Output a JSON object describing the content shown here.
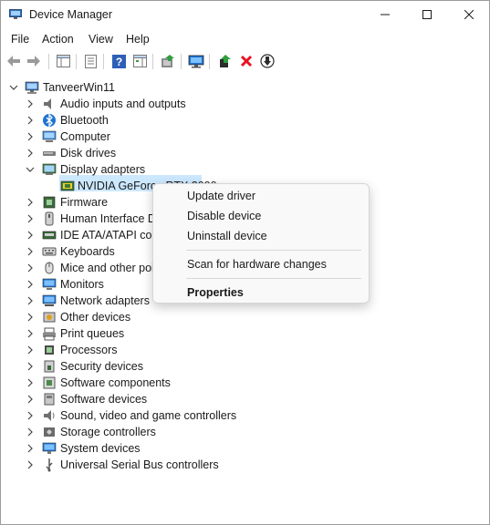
{
  "window": {
    "title": "Device Manager"
  },
  "menu": [
    "File",
    "Action",
    "View",
    "Help"
  ],
  "toolbar": {
    "icons": [
      "back-arrow-icon",
      "forward-arrow-icon",
      "show-hide-console-tree-icon",
      "properties-icon",
      "help-icon",
      "action-pane-icon",
      "update-driver-icon",
      "scan-hardware-icon",
      "enable-device-icon",
      "uninstall-icon",
      "download-driver-icon"
    ]
  },
  "tree": {
    "root": "TanveerWin11",
    "categories": [
      {
        "label": "Audio inputs and outputs",
        "icon": "speaker-icon"
      },
      {
        "label": "Bluetooth",
        "icon": "bluetooth-icon"
      },
      {
        "label": "Computer",
        "icon": "computer-icon"
      },
      {
        "label": "Disk drives",
        "icon": "disk-drive-icon"
      },
      {
        "label": "Display adapters",
        "icon": "display-adapter-icon",
        "expanded": true
      },
      {
        "label": "Firmware",
        "icon": "firmware-icon"
      },
      {
        "label": "Human Interface D",
        "icon": "hid-icon"
      },
      {
        "label": "IDE ATA/ATAPI cont",
        "icon": "ide-controller-icon"
      },
      {
        "label": "Keyboards",
        "icon": "keyboard-icon"
      },
      {
        "label": "Mice and other poi",
        "icon": "mouse-icon"
      },
      {
        "label": "Monitors",
        "icon": "monitor-icon"
      },
      {
        "label": "Network adapters",
        "icon": "network-adapter-icon"
      },
      {
        "label": "Other devices",
        "icon": "other-devices-icon"
      },
      {
        "label": "Print queues",
        "icon": "printer-icon"
      },
      {
        "label": "Processors",
        "icon": "processor-icon"
      },
      {
        "label": "Security devices",
        "icon": "security-icon"
      },
      {
        "label": "Software components",
        "icon": "software-component-icon"
      },
      {
        "label": "Software devices",
        "icon": "software-device-icon"
      },
      {
        "label": "Sound, video and game controllers",
        "icon": "sound-icon"
      },
      {
        "label": "Storage controllers",
        "icon": "storage-controller-icon"
      },
      {
        "label": "System devices",
        "icon": "system-device-icon"
      },
      {
        "label": "Universal Serial Bus controllers",
        "icon": "usb-icon"
      }
    ],
    "child": {
      "label": "NVIDIA GeForce RTX 3090",
      "icon": "gpu-icon"
    }
  },
  "context_menu": {
    "items": [
      "Update driver",
      "Disable device",
      "Uninstall device",
      "Scan for hardware changes",
      "Properties"
    ]
  },
  "colors": {
    "selection": "#cce8ff",
    "accent": "#1e73d2",
    "delete": "#e81123"
  }
}
